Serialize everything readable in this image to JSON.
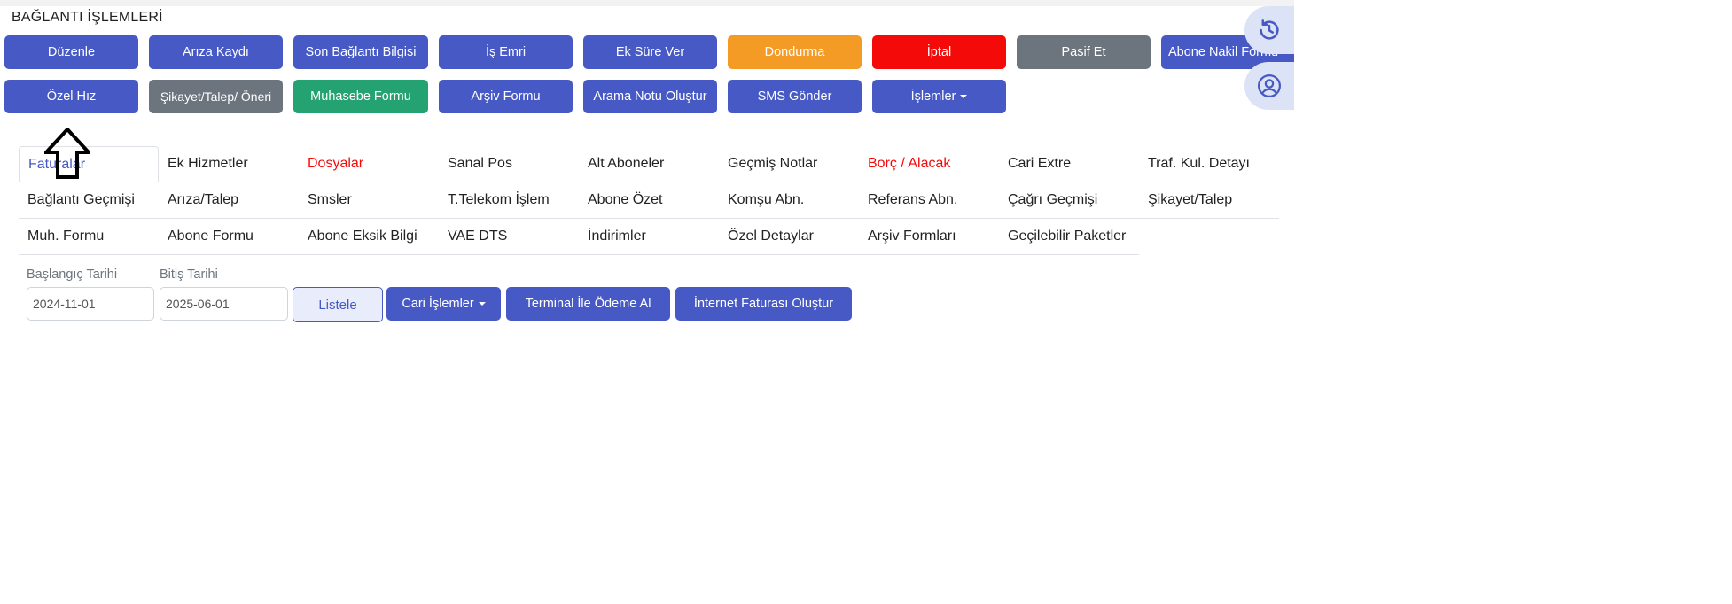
{
  "section_title": "BAĞLANTI İŞLEMLERİ",
  "actions_row1": [
    {
      "label": "Düzenle",
      "style": "primary"
    },
    {
      "label": "Arıza Kaydı",
      "style": "primary"
    },
    {
      "label": "Son Bağlantı Bilgisi",
      "style": "primary"
    },
    {
      "label": "İş Emri",
      "style": "primary"
    },
    {
      "label": "Ek Süre Ver",
      "style": "primary"
    },
    {
      "label": "Dondurma",
      "style": "warning"
    },
    {
      "label": "İptal",
      "style": "danger"
    },
    {
      "label": "Pasif Et",
      "style": "grey"
    },
    {
      "label": "Abone Nakil Formu",
      "style": "primary"
    }
  ],
  "actions_row2": [
    {
      "label": "Özel Hız",
      "style": "primary"
    },
    {
      "label": "Şikayet/Talep/ Öneri",
      "style": "grey"
    },
    {
      "label": "Muhasebe Formu",
      "style": "success"
    },
    {
      "label": "Arşiv Formu",
      "style": "primary"
    },
    {
      "label": "Arama Notu Oluştur",
      "style": "primary"
    },
    {
      "label": "SMS Gönder",
      "style": "primary"
    },
    {
      "label": "İşlemler",
      "style": "primary"
    }
  ],
  "side_icons": [
    "history-icon",
    "user-circle-icon"
  ],
  "tabs": [
    [
      "Faturalar",
      "Ek Hizmetler",
      "Dosyalar",
      "Sanal Pos",
      "Alt Aboneler",
      "Geçmiş Notlar",
      "Borç / Alacak",
      "Cari Extre",
      "Traf. Kul. Detayı"
    ],
    [
      "Bağlantı Geçmişi",
      "Arıza/Talep",
      "Smsler",
      "T.Telekom İşlem",
      "Abone Özet",
      "Komşu Abn.",
      "Referans Abn.",
      "Çağrı Geçmişi",
      "Şikayet/Talep"
    ],
    [
      "Muh. Formu",
      "Abone Formu",
      "Abone Eksik Bilgi",
      "VAE DTS",
      "İndirimler",
      "Özel Detaylar",
      "Arşiv Formları",
      "Geçilebilir Paketler"
    ]
  ],
  "active_tab": "Faturalar",
  "red_tabs": [
    "Dosyalar",
    "Borç / Alacak"
  ],
  "filters": {
    "start_label": "Başlangıç Tarihi",
    "start_value": "2024-11-01",
    "end_label": "Bitiş Tarihi",
    "end_value": "2025-06-01",
    "list_label": "Listele",
    "cari_label": "Cari İşlemler",
    "terminal_label": "Terminal İle Ödeme Al",
    "invoice_label": "İnternet Faturası Oluştur"
  },
  "colors": {
    "primary": "#4759c4",
    "warning": "#f49b25",
    "danger": "#f50a0a",
    "grey": "#6c757d",
    "success": "#24a271"
  }
}
